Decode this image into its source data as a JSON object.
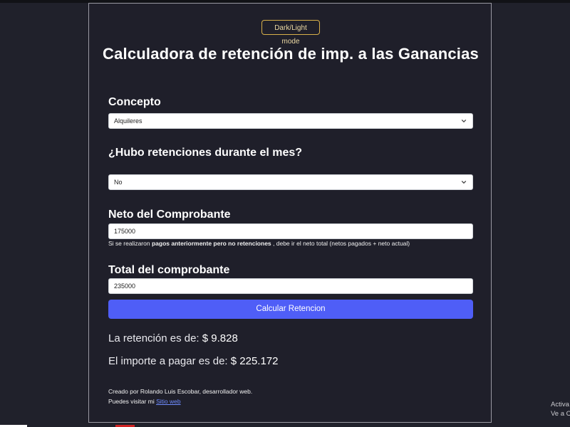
{
  "header": {
    "mode_toggle_label": "Dark/Light mode",
    "title": "Calculadora de retención de imp. a las Ganancias"
  },
  "form": {
    "concepto": {
      "label": "Concepto",
      "selected": "Alquileres"
    },
    "retenciones": {
      "label": "¿Hubo retenciones durante el mes?",
      "selected": "No"
    },
    "neto": {
      "label": "Neto del Comprobante",
      "value": "175000",
      "hint_prefix": "Si se realizaron",
      "hint_bold": "pagos anteriormente pero no retenciones",
      "hint_suffix": ", debe ir el neto total (netos pagados + neto actual)"
    },
    "total": {
      "label": "Total del comprobante",
      "value": "235000"
    },
    "submit_label": "Calcular Retencion"
  },
  "results": {
    "retencion_label": "La retención es de:",
    "retencion_value": "$ 9.828",
    "importe_label": "El importe a pagar es de:",
    "importe_value": "$ 225.172"
  },
  "footer": {
    "credit_line": "Creado por Rolando Luis Escobar, desarrollador web.",
    "visit_prefix": "Puedes visitar mi",
    "site_link": "Sitio web"
  },
  "os_overlay": {
    "line1": "Activa",
    "line2": "Ve a C"
  }
}
